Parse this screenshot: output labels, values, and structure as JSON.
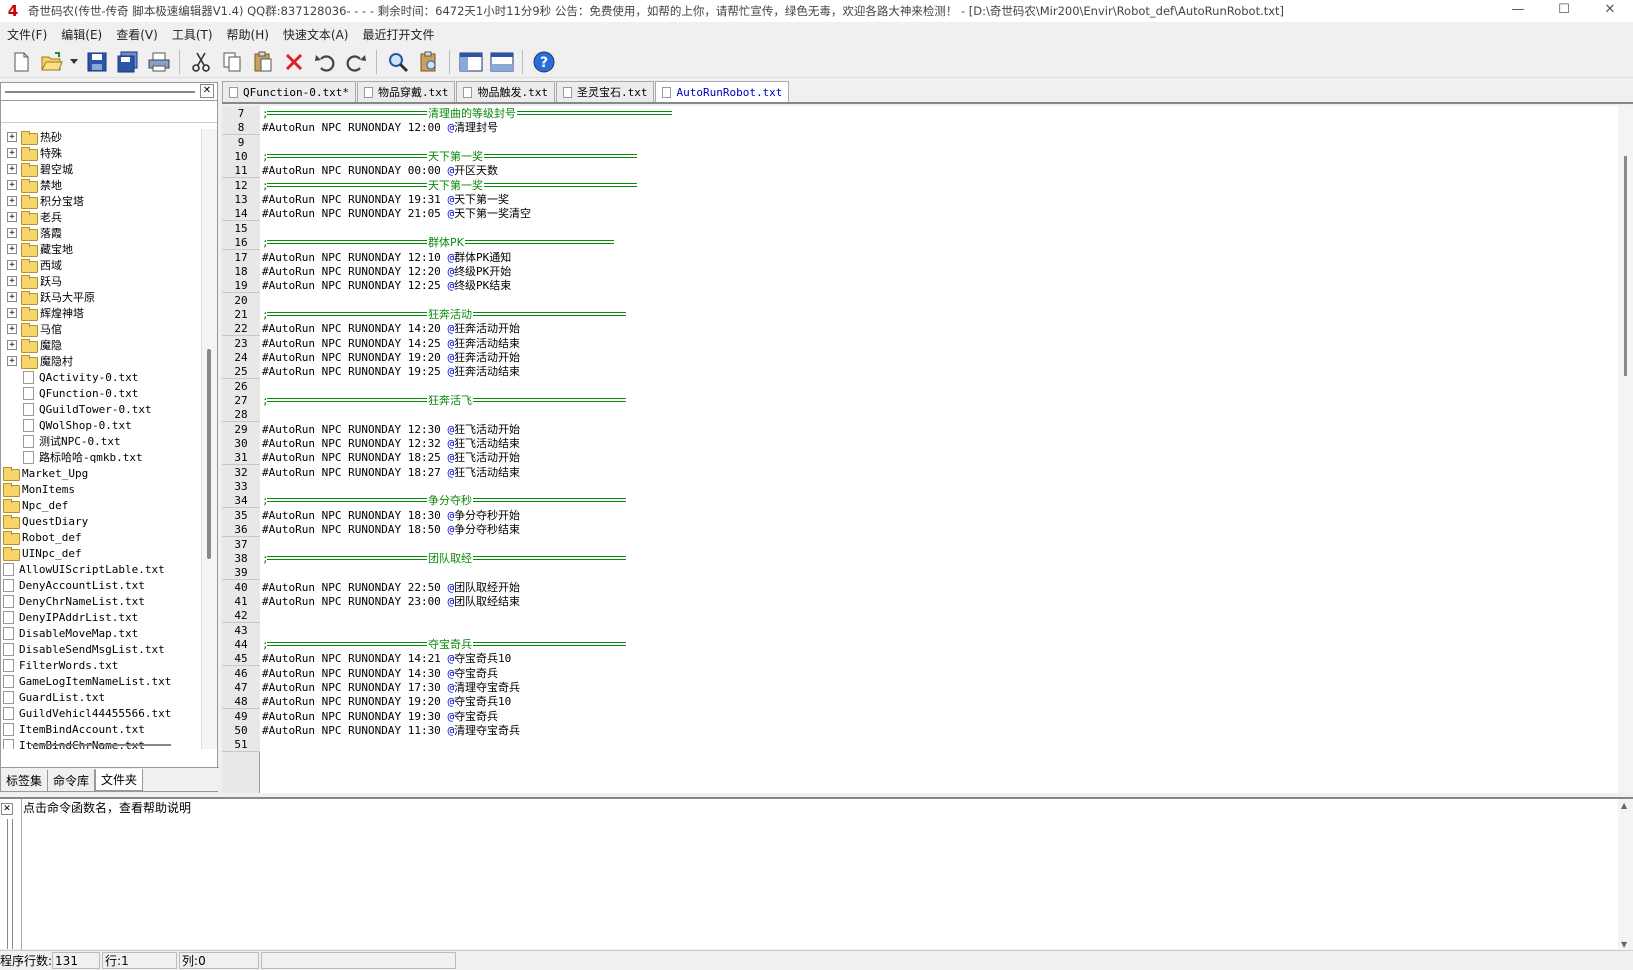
{
  "window": {
    "title": "奇世码农(传世-传奇 脚本极速编辑器V1.4) QQ群:837128036- - - - 剩余时间：6472天1小时11分9秒      公告：免费使用，如帮的上你，请帮忙宣传，绿色无毒，欢迎各路大神来检测！ - [D:\\奇世码农\\Mir200\\Envir\\Robot_def\\AutoRunRobot.txt]",
    "minimize": "—",
    "maximize": "☐",
    "close": "✕"
  },
  "menu": [
    "文件(F)",
    "编辑(E)",
    "查看(V)",
    "工具(T)",
    "帮助(H)",
    "快速文本(A)",
    "最近打开文件"
  ],
  "toolbar": {
    "icons": [
      "new-file-icon",
      "open-folder-icon",
      "dropdown-arrow-icon",
      "save-icon",
      "save-all-icon",
      "print-icon",
      "cut-icon",
      "copy-icon",
      "paste-icon",
      "delete-icon",
      "undo-icon",
      "redo-icon",
      "find-icon",
      "replace-icon",
      "toggle-panel-icon",
      "toggle-output-icon",
      "help-icon"
    ]
  },
  "left_panel": {
    "close": "✕",
    "tree": [
      {
        "label": "热砂",
        "type": "folder",
        "indent": 1
      },
      {
        "label": "特殊",
        "type": "folder",
        "indent": 1
      },
      {
        "label": "碧空城",
        "type": "folder",
        "indent": 1
      },
      {
        "label": "禁地",
        "type": "folder",
        "indent": 1
      },
      {
        "label": "积分宝塔",
        "type": "folder",
        "indent": 1
      },
      {
        "label": "老兵",
        "type": "folder",
        "indent": 1
      },
      {
        "label": "落霞",
        "type": "folder",
        "indent": 1
      },
      {
        "label": "藏宝地",
        "type": "folder",
        "indent": 1
      },
      {
        "label": "西域",
        "type": "folder",
        "indent": 1
      },
      {
        "label": "跃马",
        "type": "folder",
        "indent": 1
      },
      {
        "label": "跃马大平原",
        "type": "folder",
        "indent": 1
      },
      {
        "label": "辉煌神塔",
        "type": "folder",
        "indent": 1
      },
      {
        "label": "马倌",
        "type": "folder",
        "indent": 1
      },
      {
        "label": "魔隐",
        "type": "folder",
        "indent": 1
      },
      {
        "label": "魔隐村",
        "type": "folder",
        "indent": 1
      },
      {
        "label": "QActivity-0.txt",
        "type": "file",
        "indent": 2
      },
      {
        "label": "QFunction-0.txt",
        "type": "file",
        "indent": 2
      },
      {
        "label": "QGuildTower-0.txt",
        "type": "file",
        "indent": 2
      },
      {
        "label": "QWolShop-0.txt",
        "type": "file",
        "indent": 2
      },
      {
        "label": "测试NPC-0.txt",
        "type": "file",
        "indent": 2
      },
      {
        "label": "路标哈哈-qmkb.txt",
        "type": "file",
        "indent": 2
      },
      {
        "label": "Market_Upg",
        "type": "folder",
        "indent": 0
      },
      {
        "label": "MonItems",
        "type": "folder",
        "indent": 0
      },
      {
        "label": "Npc_def",
        "type": "folder",
        "indent": 0
      },
      {
        "label": "QuestDiary",
        "type": "folder",
        "indent": 0
      },
      {
        "label": "Robot_def",
        "type": "folder",
        "indent": 0
      },
      {
        "label": "UINpc_def",
        "type": "folder",
        "indent": 0
      },
      {
        "label": "AllowUIScriptLable.txt",
        "type": "file",
        "indent": 0
      },
      {
        "label": "DenyAccountList.txt",
        "type": "file",
        "indent": 0
      },
      {
        "label": "DenyChrNameList.txt",
        "type": "file",
        "indent": 0
      },
      {
        "label": "DenyIPAddrList.txt",
        "type": "file",
        "indent": 0
      },
      {
        "label": "DisableMoveMap.txt",
        "type": "file",
        "indent": 0
      },
      {
        "label": "DisableSendMsgList.txt",
        "type": "file",
        "indent": 0
      },
      {
        "label": "FilterWords.txt",
        "type": "file",
        "indent": 0
      },
      {
        "label": "GameLogItemNameList.txt",
        "type": "file",
        "indent": 0
      },
      {
        "label": "GuardList.txt",
        "type": "file",
        "indent": 0
      },
      {
        "label": "GuildVehicl44455566.txt",
        "type": "file",
        "indent": 0
      },
      {
        "label": "ItemBindAccount.txt",
        "type": "file",
        "indent": 0
      },
      {
        "label": "ItemBindChrName.txt",
        "type": "file",
        "indent": 0
      }
    ],
    "tabs": [
      "标签集",
      "命令库",
      "文件夹"
    ],
    "active_tab": 2
  },
  "doc_tabs": [
    "QFunction-0.txt*",
    "物品穿戴.txt",
    "物品触发.txt",
    "圣灵宝石.txt",
    "AutoRunRobot.txt"
  ],
  "active_doc_tab": 4,
  "editor": {
    "lines": [
      {
        "n": "7",
        "kind": "section",
        "label": "清理曲的等级封号",
        "rule_end": 450
      },
      {
        "n": "8",
        "kind": "code",
        "text": "#AutoRun NPC RUNONDAY 12:00 ",
        "at": "@",
        "tail": "清理封号"
      },
      {
        "n": "9",
        "kind": "blank"
      },
      {
        "n": "10",
        "kind": "section",
        "label": "天下第一奖",
        "rule_end": 415
      },
      {
        "n": "11",
        "kind": "code",
        "text": "#AutoRun NPC RUNONDAY 00:00 ",
        "at": "@",
        "tail": "开区天数"
      },
      {
        "n": "12",
        "kind": "section",
        "label": "天下第一奖",
        "rule_end": 415
      },
      {
        "n": "13",
        "kind": "code",
        "text": "#AutoRun NPC RUNONDAY 19:31 ",
        "at": "@",
        "tail": "天下第一奖"
      },
      {
        "n": "14",
        "kind": "code",
        "text": "#AutoRun NPC RUNONDAY 21:05 ",
        "at": "@",
        "tail": "天下第一奖清空"
      },
      {
        "n": "15",
        "kind": "blank"
      },
      {
        "n": "16",
        "kind": "section",
        "label": "群体PK",
        "rule_end": 392
      },
      {
        "n": "17",
        "kind": "code",
        "text": "#AutoRun NPC RUNONDAY 12:10 ",
        "at": "@",
        "tail": "群体PK通知"
      },
      {
        "n": "18",
        "kind": "code",
        "text": "#AutoRun NPC RUNONDAY 12:20 ",
        "at": "@",
        "tail": "终级PK开始"
      },
      {
        "n": "19",
        "kind": "code",
        "text": "#AutoRun NPC RUNONDAY 12:25 ",
        "at": "@",
        "tail": "终级PK结束"
      },
      {
        "n": "20",
        "kind": "blank"
      },
      {
        "n": "21",
        "kind": "section",
        "label": "狂奔活动",
        "rule_end": 404
      },
      {
        "n": "22",
        "kind": "code",
        "text": "#AutoRun NPC RUNONDAY 14:20 ",
        "at": "@",
        "tail": "狂奔活动开始"
      },
      {
        "n": "23",
        "kind": "code",
        "text": "#AutoRun NPC RUNONDAY 14:25 ",
        "at": "@",
        "tail": "狂奔活动结束"
      },
      {
        "n": "24",
        "kind": "code",
        "text": "#AutoRun NPC RUNONDAY 19:20 ",
        "at": "@",
        "tail": "狂奔活动开始"
      },
      {
        "n": "25",
        "kind": "code",
        "text": "#AutoRun NPC RUNONDAY 19:25 ",
        "at": "@",
        "tail": "狂奔活动结束"
      },
      {
        "n": "26",
        "kind": "blank"
      },
      {
        "n": "27",
        "kind": "section",
        "label": "狂奔活飞",
        "rule_end": 404
      },
      {
        "n": "28",
        "kind": "blank"
      },
      {
        "n": "29",
        "kind": "code",
        "text": "#AutoRun NPC RUNONDAY 12:30 ",
        "at": "@",
        "tail": "狂飞活动开始"
      },
      {
        "n": "30",
        "kind": "code",
        "text": "#AutoRun NPC RUNONDAY 12:32 ",
        "at": "@",
        "tail": "狂飞活动结束"
      },
      {
        "n": "31",
        "kind": "code",
        "text": "#AutoRun NPC RUNONDAY 18:25 ",
        "at": "@",
        "tail": "狂飞活动开始"
      },
      {
        "n": "32",
        "kind": "code",
        "text": "#AutoRun NPC RUNONDAY 18:27 ",
        "at": "@",
        "tail": "狂飞活动结束"
      },
      {
        "n": "33",
        "kind": "blank"
      },
      {
        "n": "34",
        "kind": "section",
        "label": "争分夺秒",
        "rule_end": 404
      },
      {
        "n": "35",
        "kind": "code",
        "text": "#AutoRun NPC RUNONDAY 18:30 ",
        "at": "@",
        "tail": "争分夺秒开始"
      },
      {
        "n": "36",
        "kind": "code",
        "text": "#AutoRun NPC RUNONDAY 18:50 ",
        "at": "@",
        "tail": "争分夺秒结束"
      },
      {
        "n": "37",
        "kind": "blank"
      },
      {
        "n": "38",
        "kind": "section",
        "label": "团队取经",
        "rule_end": 404
      },
      {
        "n": "39",
        "kind": "blank"
      },
      {
        "n": "40",
        "kind": "code",
        "text": "#AutoRun NPC RUNONDAY 22:50 ",
        "at": "@",
        "tail": "团队取经开始"
      },
      {
        "n": "41",
        "kind": "code",
        "text": "#AutoRun NPC RUNONDAY 23:00 ",
        "at": "@",
        "tail": "团队取经结束"
      },
      {
        "n": "42",
        "kind": "blank"
      },
      {
        "n": "43",
        "kind": "blank"
      },
      {
        "n": "44",
        "kind": "section",
        "label": "夺宝奇兵",
        "rule_end": 404
      },
      {
        "n": "45",
        "kind": "code",
        "text": "#AutoRun NPC RUNONDAY 14:21 ",
        "at": "@",
        "tail": "夺宝奇兵10"
      },
      {
        "n": "46",
        "kind": "code",
        "text": "#AutoRun NPC RUNONDAY 14:30 ",
        "at": "@",
        "tail": "夺宝奇兵"
      },
      {
        "n": "47",
        "kind": "code",
        "text": "#AutoRun NPC RUNONDAY 17:30 ",
        "at": "@",
        "tail": "清理夺宝奇兵"
      },
      {
        "n": "48",
        "kind": "code",
        "text": "#AutoRun NPC RUNONDAY 19:20 ",
        "at": "@",
        "tail": "夺宝奇兵10"
      },
      {
        "n": "49",
        "kind": "code",
        "text": "#AutoRun NPC RUNONDAY 19:30 ",
        "at": "@",
        "tail": "夺宝奇兵"
      },
      {
        "n": "50",
        "kind": "code",
        "text": "#AutoRun NPC RUNONDAY 11:30 ",
        "at": "@",
        "tail": "清理夺宝奇兵"
      },
      {
        "n": "51",
        "kind": "blank"
      }
    ]
  },
  "help_panel": {
    "text": "点击命令函数名，查看帮助说明",
    "close": "✕"
  },
  "status": {
    "lines_label": "程序行数:",
    "lines_value": "131",
    "row_label": "行:1",
    "col_label": "列:0"
  },
  "colors": {
    "section": "#0a8a0a",
    "at_sign": "#0000cc",
    "active_tab_text": "#0000c0"
  }
}
